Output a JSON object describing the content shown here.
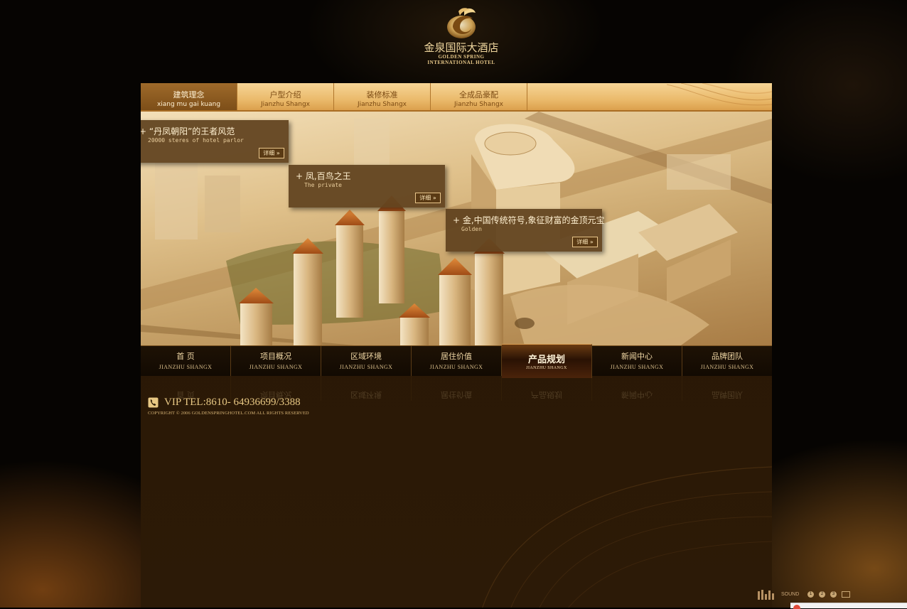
{
  "logo": {
    "name_cn": "金泉国际大酒店",
    "name_en_line1": "GOLDEN SPRING",
    "name_en_line2": "INTERNATIONAL HOTEL"
  },
  "top_tabs": [
    {
      "cn": "建筑理念",
      "en": "xiang mu gai kuang",
      "active": true
    },
    {
      "cn": "户型介绍",
      "en": "Jianzhu  Shangx",
      "active": false
    },
    {
      "cn": "装修标准",
      "en": "Jianzhu  Shangx",
      "active": false
    },
    {
      "cn": "全成品豪配",
      "en": "Jianzhu  Shangx",
      "active": false
    }
  ],
  "callouts": [
    {
      "title": "+  “丹凤朝阳”的王者风范",
      "subtitle": "20000 steres of hotel parlor",
      "button": "详细"
    },
    {
      "title": "+ 凤,百鸟之王",
      "subtitle": "The private",
      "button": "详细"
    },
    {
      "title": "+ 金,中国传统符号,象征财富的金顶元宝",
      "subtitle": "Golden",
      "button": "详细"
    }
  ],
  "bottom_nav": [
    {
      "cn": "首  页",
      "en": "JIANZHU  SHANGX",
      "active": false
    },
    {
      "cn": "项目概况",
      "en": "JIANZHU  SHANGX",
      "active": false
    },
    {
      "cn": "区域环境",
      "en": "JIANZHU  SHANGX",
      "active": false
    },
    {
      "cn": "居住价值",
      "en": "JIANZHU  SHANGX",
      "active": false
    },
    {
      "cn": "产品规划",
      "en": "JIANZHU  SHANGX",
      "active": true
    },
    {
      "cn": "新闻中心",
      "en": "JIANZHU  SHANGX",
      "active": false
    },
    {
      "cn": "品牌团队",
      "en": "JIANZHU  SHANGX",
      "active": false
    }
  ],
  "footer": {
    "vip_tel": "VIP TEL:8610- 64936699/3388",
    "copyright": "COPYRIGHT © 2006  GOLDENSPRINGHOTEL.COM  ALL RIGHTS RESERVED"
  },
  "sound_bar": {
    "label": "SOUND",
    "buttons": [
      "1",
      "2",
      "3"
    ],
    "icons": [
      "equalizer-icon",
      "mail-icon"
    ]
  },
  "colors": {
    "accent_gold": "#e8c884",
    "panel_brown": "#2b1a06",
    "tab_gold": "#eab96a"
  }
}
